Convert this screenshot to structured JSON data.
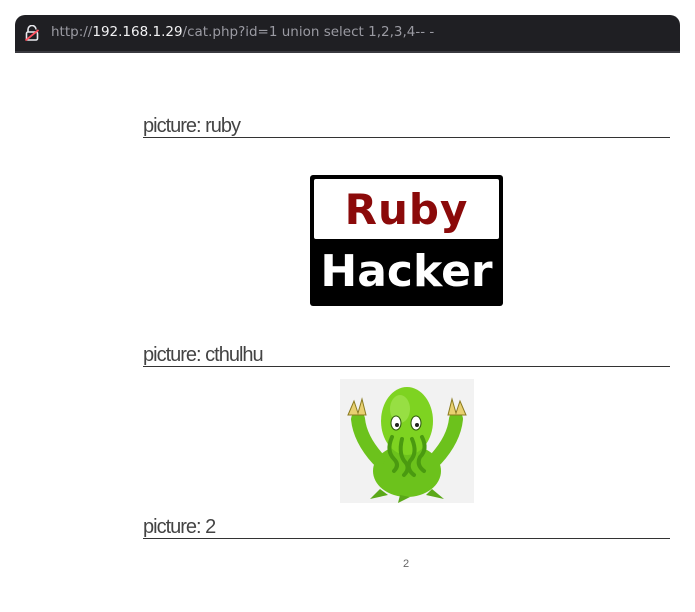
{
  "browser": {
    "url_scheme": "http://",
    "url_host": "192.168.1.29",
    "url_path": "/cat.php?id=1 union select 1,2,3,4-- -",
    "lock_icon": "insecure-lock-icon"
  },
  "pictures": [
    {
      "heading": "picture: ruby",
      "logo_top": "Ruby",
      "logo_bottom": "Hacker"
    },
    {
      "heading": "picture: cthulhu",
      "image_icon": "cthulhu-icon"
    },
    {
      "heading": "picture: 2",
      "caption": "2"
    }
  ]
}
